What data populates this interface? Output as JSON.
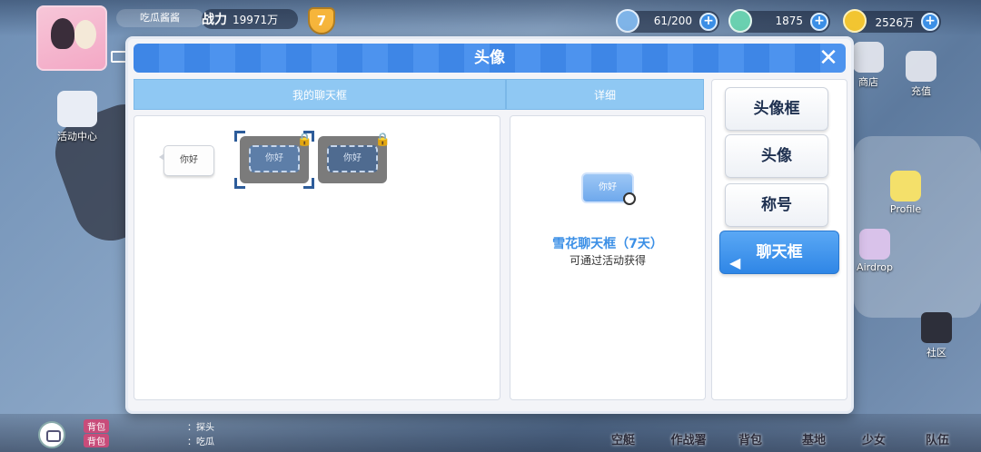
{
  "hud": {
    "player_name": "吃瓜酱酱",
    "power_label": "战力",
    "power_value": "19971万",
    "level": "7",
    "resources": [
      {
        "icon": "energy-icon",
        "value": "61/200"
      },
      {
        "icon": "feather-icon",
        "value": "1875"
      },
      {
        "icon": "gold-coin-icon",
        "value": "2526万"
      }
    ],
    "left_side": {
      "label": "活动中心"
    },
    "right_side": [
      {
        "label": "商店"
      },
      {
        "label": "充值"
      },
      {
        "label": "Profile"
      },
      {
        "label": "Airdrop"
      },
      {
        "label": "社区"
      }
    ],
    "chat": [
      {
        "tag": "背包",
        "text": "：探头"
      },
      {
        "tag": "背包",
        "text": "：吃瓜"
      }
    ],
    "nav": [
      "空艇",
      "作战署",
      "背包",
      "基地",
      "少女",
      "队伍"
    ]
  },
  "modal": {
    "title": "头像",
    "tabs": {
      "left": "我的聊天框",
      "right": "详细"
    },
    "frames": [
      {
        "text": "你好",
        "locked": false,
        "type": "default"
      },
      {
        "text": "你好",
        "locked": true,
        "type": "snowflake",
        "selected": true
      },
      {
        "text": "你好",
        "locked": true,
        "type": "snowflake-dark"
      }
    ],
    "detail": {
      "preview_text": "你好",
      "name": "雪花聊天框（7天）",
      "description": "可通过活动获得"
    },
    "side_buttons": [
      {
        "label": "头像框",
        "active": false
      },
      {
        "label": "头像",
        "active": false
      },
      {
        "label": "称号",
        "active": false
      },
      {
        "label": "聊天框",
        "active": true
      }
    ]
  }
}
